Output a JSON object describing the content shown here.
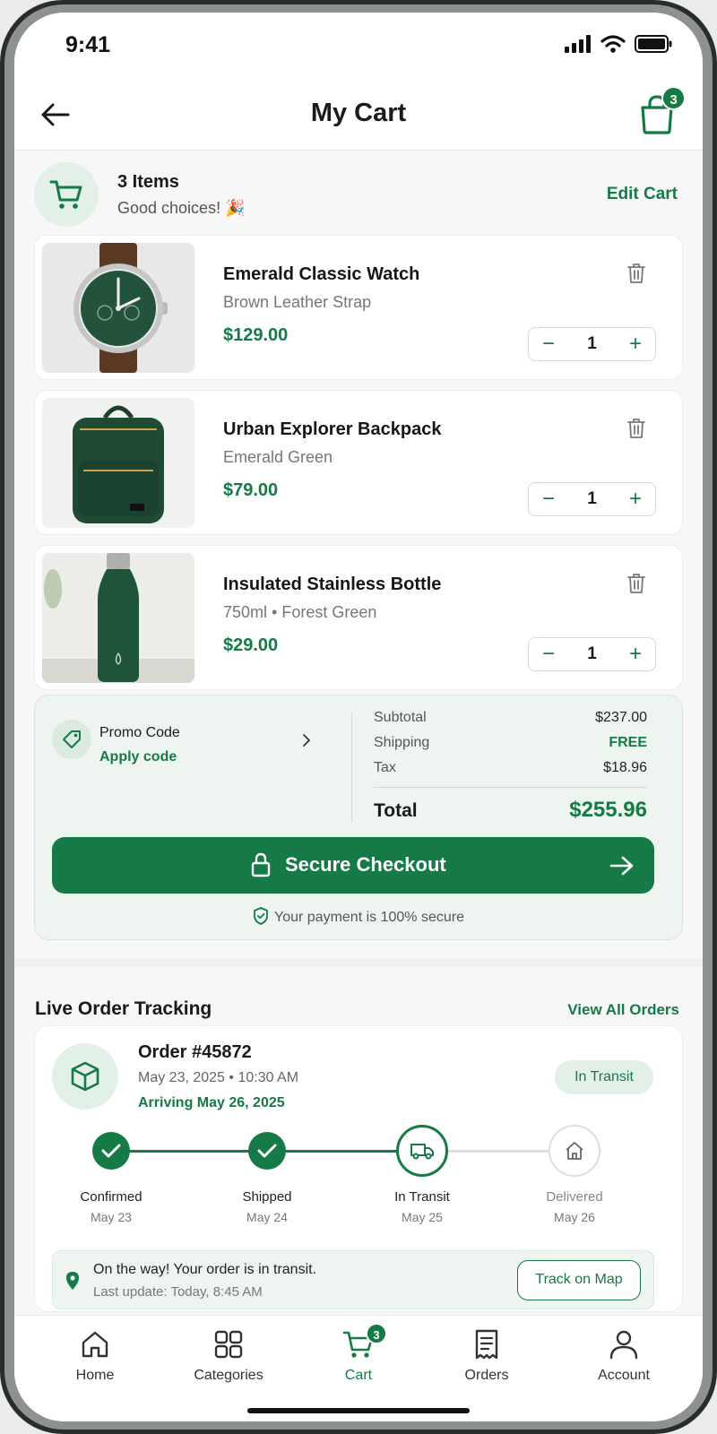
{
  "status_bar": {
    "time": "9:41"
  },
  "header": {
    "title": "My Cart",
    "cart_badge": "3"
  },
  "cart_summary": {
    "count_label": "3 Items",
    "subtitle": "Good choices! 🎉",
    "edit_label": "Edit Cart"
  },
  "items": [
    {
      "name": "Emerald Classic Watch",
      "variant": "Brown Leather Strap",
      "price": "$129.00",
      "qty": "1",
      "thumb": "watch"
    },
    {
      "name": "Urban Explorer Backpack",
      "variant": "Emerald Green",
      "price": "$79.00",
      "qty": "1",
      "thumb": "backpack"
    },
    {
      "name": "Insulated Stainless Bottle",
      "variant": "750ml • Forest Green",
      "price": "$29.00",
      "qty": "1",
      "thumb": "bottle"
    }
  ],
  "stepper": {
    "minus": "−",
    "plus": "+"
  },
  "promo": {
    "title": "Promo Code",
    "link": "Apply code"
  },
  "totals": {
    "subtotal_label": "Subtotal",
    "subtotal": "$237.00",
    "shipping_label": "Shipping",
    "shipping": "FREE",
    "tax_label": "Tax",
    "tax": "$18.96",
    "total_label": "Total",
    "total": "$255.96"
  },
  "checkout": {
    "button_label": "Secure Checkout",
    "secure_note": "Your payment is 100% secure"
  },
  "tracking": {
    "title": "Live Order Tracking",
    "view_all": "View All Orders",
    "order_no": "Order #45872",
    "order_date": "May 23, 2025 • 10:30 AM",
    "arrival": "Arriving May 26, 2025",
    "status_pill": "In Transit",
    "steps": [
      {
        "label": "Confirmed",
        "date": "May 23",
        "state": "done"
      },
      {
        "label": "Shipped",
        "date": "May 24",
        "state": "done"
      },
      {
        "label": "In Transit",
        "date": "May 25",
        "state": "current"
      },
      {
        "label": "Delivered",
        "date": "May 26",
        "state": "pending"
      }
    ],
    "transit_message": "On the way! Your order is in transit.",
    "last_update": "Last update: Today, 8:45 AM",
    "track_button": "Track on Map"
  },
  "nav": {
    "items": [
      {
        "label": "Home",
        "icon": "home-icon"
      },
      {
        "label": "Categories",
        "icon": "grid-icon"
      },
      {
        "label": "Cart",
        "icon": "cart-icon",
        "active": true,
        "badge": "3"
      },
      {
        "label": "Orders",
        "icon": "receipt-icon"
      },
      {
        "label": "Account",
        "icon": "person-icon"
      }
    ]
  },
  "colors": {
    "accent": "#157a45",
    "accent_light": "#e3f0e8",
    "panel": "#eef5f0"
  }
}
